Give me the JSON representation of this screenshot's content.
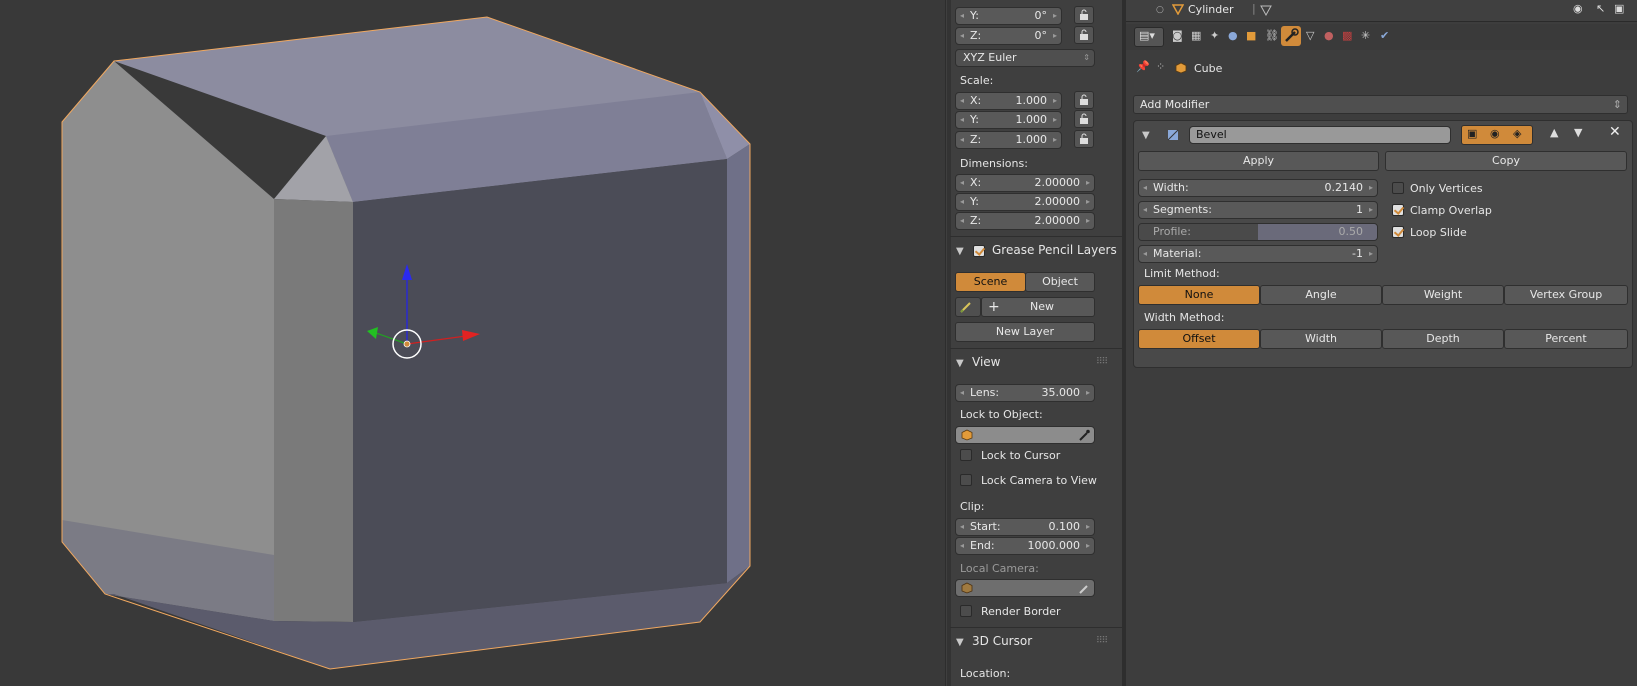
{
  "rotation": {
    "y": {
      "label": "Y:",
      "value": "0°"
    },
    "z": {
      "label": "Z:",
      "value": "0°"
    },
    "mode": "XYZ Euler"
  },
  "scale": {
    "title": "Scale:",
    "x": {
      "label": "X:",
      "value": "1.000"
    },
    "y": {
      "label": "Y:",
      "value": "1.000"
    },
    "z": {
      "label": "Z:",
      "value": "1.000"
    }
  },
  "dimensions": {
    "title": "Dimensions:",
    "x": {
      "label": "X:",
      "value": "2.00000"
    },
    "y": {
      "label": "Y:",
      "value": "2.00000"
    },
    "z": {
      "label": "Z:",
      "value": "2.00000"
    }
  },
  "grease_pencil": {
    "title": "Grease Pencil Layers",
    "scene_tab": "Scene",
    "object_tab": "Object",
    "new_label": "New",
    "new_layer_label": "New Layer"
  },
  "view": {
    "title": "View",
    "lens": {
      "label": "Lens:",
      "value": "35.000"
    },
    "lock_to_object": "Lock to Object:",
    "lock_to_cursor": "Lock to Cursor",
    "lock_camera": "Lock Camera to View",
    "clip_title": "Clip:",
    "clip_start": {
      "label": "Start:",
      "value": "0.100"
    },
    "clip_end": {
      "label": "End:",
      "value": "1000.000"
    },
    "local_camera": "Local Camera:",
    "render_border": "Render Border"
  },
  "cursor3d": {
    "title": "3D Cursor",
    "location": "Location:"
  },
  "outliner": {
    "item": "Cylinder"
  },
  "properties": {
    "breadcrumb": "Cube",
    "add_modifier": "Add Modifier",
    "modifier_name": "Bevel",
    "apply": "Apply",
    "copy": "Copy",
    "width": {
      "label": "Width:",
      "value": "0.2140"
    },
    "segments": {
      "label": "Segments:",
      "value": "1"
    },
    "profile": {
      "label": "Profile:",
      "value": "0.50"
    },
    "material": {
      "label": "Material:",
      "value": "-1"
    },
    "only_vertices": "Only Vertices",
    "clamp_overlap": "Clamp Overlap",
    "loop_slide": "Loop Slide",
    "limit_method_title": "Limit Method:",
    "limit_methods": [
      "None",
      "Angle",
      "Weight",
      "Vertex Group"
    ],
    "width_method_title": "Width Method:",
    "width_methods": [
      "Offset",
      "Width",
      "Depth",
      "Percent"
    ]
  },
  "colors": {
    "accent": "#d08a3a",
    "background": "#393939",
    "selection_outline": "#f0a860"
  }
}
